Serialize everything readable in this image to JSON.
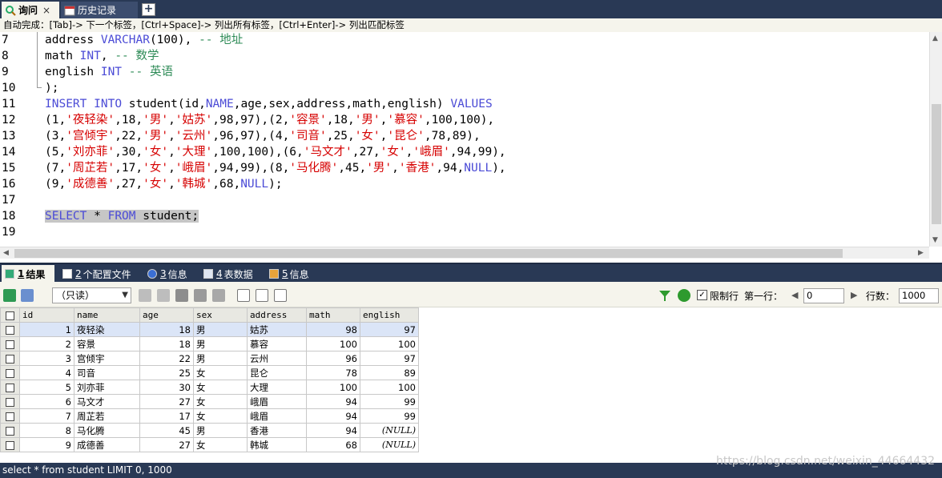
{
  "tabs": [
    {
      "label": "询问",
      "close": "×",
      "active": true
    },
    {
      "label": "历史记录",
      "active": false
    }
  ],
  "add_tab": "+",
  "hint": "自动完成：[Tab]-> 下一个标签，[Ctrl+Space]-> 列出所有标签，[Ctrl+Enter]-> 列出匹配标签",
  "editor": {
    "line_numbers": [
      "7",
      "8",
      "9",
      "10",
      "11",
      "12",
      "13",
      "14",
      "15",
      "16",
      "17",
      "18",
      "19"
    ]
  },
  "result_tabs": [
    {
      "num": "1",
      "label": "结果",
      "active": true
    },
    {
      "num": "2",
      "label": "个配置文件"
    },
    {
      "num": "3",
      "label": "信息"
    },
    {
      "num": "4",
      "label": "表数据"
    },
    {
      "num": "5",
      "label": "信息"
    }
  ],
  "toolbar": {
    "mode_select": "（只读）",
    "limit_label": "限制行",
    "limit_checked": "✓",
    "first_row_label": "第一行：",
    "first_row_value": "0",
    "rows_label": "行数：",
    "rows_value": "1000"
  },
  "grid": {
    "columns": [
      "id",
      "name",
      "age",
      "sex",
      "address",
      "math",
      "english"
    ],
    "rows": [
      [
        "1",
        "夜轻染",
        "18",
        "男",
        "姑苏",
        "98",
        "97"
      ],
      [
        "2",
        "容景",
        "18",
        "男",
        "慕容",
        "100",
        "100"
      ],
      [
        "3",
        "宫倾宇",
        "22",
        "男",
        "云州",
        "96",
        "97"
      ],
      [
        "4",
        "司音",
        "25",
        "女",
        "昆仑",
        "78",
        "89"
      ],
      [
        "5",
        "刘亦菲",
        "30",
        "女",
        "大理",
        "100",
        "100"
      ],
      [
        "6",
        "马文才",
        "27",
        "女",
        "峨眉",
        "94",
        "99"
      ],
      [
        "7",
        "周芷若",
        "17",
        "女",
        "峨眉",
        "94",
        "99"
      ],
      [
        "8",
        "马化腾",
        "45",
        "男",
        "香港",
        "94",
        "(NULL)"
      ],
      [
        "9",
        "成德善",
        "27",
        "女",
        "韩城",
        "68",
        "(NULL)"
      ]
    ]
  },
  "status_text": "select * from student LIMIT 0, 1000",
  "watermark": "https://blog.csdn.net/weixin_44664432",
  "colors": {
    "frame": "#293955",
    "keyword": "#4b4bd6",
    "string": "#d60000",
    "comment": "#2e8b57"
  }
}
